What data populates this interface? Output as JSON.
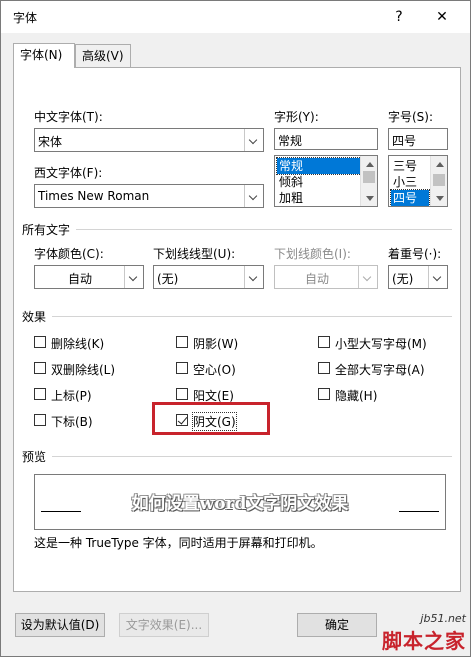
{
  "window": {
    "title": "字体",
    "help": "?",
    "close": "✕"
  },
  "tabs": [
    {
      "label": "字体(N)"
    },
    {
      "label": "高级(V)"
    }
  ],
  "font": {
    "chinese_label": "中文字体(T):",
    "chinese_value": "宋体",
    "western_label": "西文字体(F):",
    "western_value": "Times New Roman",
    "style_label": "字形(Y):",
    "style_value": "常规",
    "style_list": [
      "常规",
      "倾斜",
      "加粗"
    ],
    "size_label": "字号(S):",
    "size_value": "四号",
    "size_list": [
      "三号",
      "小三",
      "四号"
    ]
  },
  "all_text": {
    "section": "所有文字",
    "color_label": "字体颜色(C):",
    "color_value": "自动",
    "underline_label": "下划线线型(U):",
    "underline_value": "(无)",
    "underline_color_label": "下划线颜色(I):",
    "underline_color_value": "自动",
    "emphasis_label": "着重号(·):",
    "emphasis_value": "(无)"
  },
  "effects": {
    "section": "效果",
    "items": [
      {
        "label": "删除线(K)",
        "checked": false
      },
      {
        "label": "双删除线(L)",
        "checked": false
      },
      {
        "label": "上标(P)",
        "checked": false
      },
      {
        "label": "下标(B)",
        "checked": false
      },
      {
        "label": "阴影(W)",
        "checked": false
      },
      {
        "label": "空心(O)",
        "checked": false
      },
      {
        "label": "阳文(E)",
        "checked": false
      },
      {
        "label": "阴文(G)",
        "checked": true
      },
      {
        "label": "小型大写字母(M)",
        "checked": false
      },
      {
        "label": "全部大写字母(A)",
        "checked": false
      },
      {
        "label": "隐藏(H)",
        "checked": false
      }
    ]
  },
  "preview": {
    "section": "预览",
    "sample": "如何设置word文字阴文效果",
    "note": "这是一种 TrueType 字体，同时适用于屏幕和打印机。"
  },
  "buttons": {
    "default": "设为默认值(D)",
    "text_effects": "文字效果(E)...",
    "ok": "确定"
  },
  "watermark": {
    "site": "jb51.net",
    "brand": "脚本之家"
  },
  "colors": {
    "accent": "#0078d7",
    "highlight": "#c8232c"
  }
}
